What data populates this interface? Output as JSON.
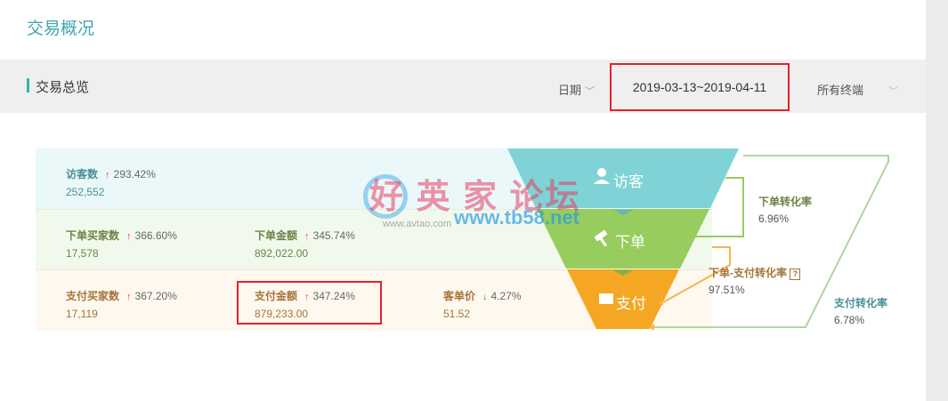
{
  "page_title": "交易概况",
  "overview": {
    "title": "交易总览",
    "date_label": "日期",
    "date_range": "2019-03-13~2019-04-11",
    "terminal": "所有终端"
  },
  "rows": {
    "visitors": {
      "name": "访客数",
      "pct": "293.42%",
      "value": "252,552"
    },
    "order_buyers": {
      "name": "下单买家数",
      "pct": "366.60%",
      "value": "17,578"
    },
    "order_amount": {
      "name": "下单金额",
      "pct": "345.74%",
      "value": "892,022.00"
    },
    "pay_buyers": {
      "name": "支付买家数",
      "pct": "367.20%",
      "value": "17,119"
    },
    "pay_amount": {
      "name": "支付金额",
      "pct": "347.24%",
      "value": "879,233.00"
    },
    "unit_price": {
      "name": "客单价",
      "pct": "4.27%",
      "value": "51.52"
    }
  },
  "funnel": {
    "stage1": "访客",
    "stage2": "下单",
    "stage3": "支付"
  },
  "rates": {
    "order_rate": {
      "name": "下单转化率",
      "value": "6.96%"
    },
    "order_pay_rate": {
      "name": "下单-支付转化率",
      "value": "97.51%"
    },
    "pay_rate": {
      "name": "支付转化率",
      "value": "6.78%"
    }
  },
  "watermark": {
    "text": "好 英 家 论坛",
    "url": "www.tb58.net",
    "sub": "www.avtao.com"
  },
  "colors": {
    "accent": "#3fa7b3",
    "visit": "#7fd3d6",
    "order": "#97cc5f",
    "pay": "#f5a623",
    "highlight": "#e8202a"
  }
}
